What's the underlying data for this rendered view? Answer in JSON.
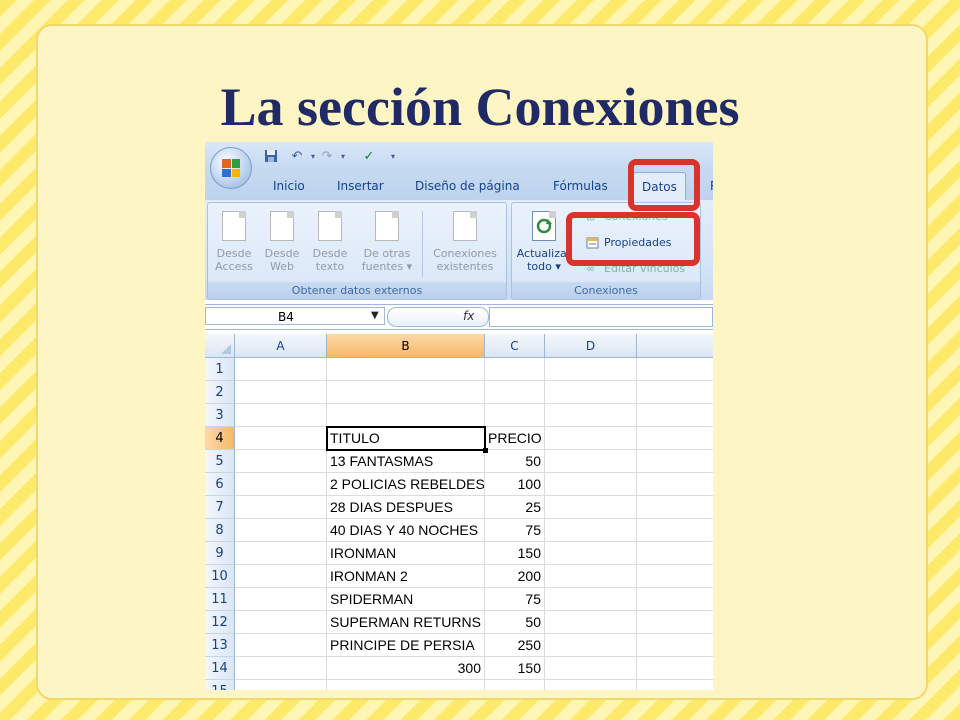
{
  "slide": {
    "title": "La sección Conexiones"
  },
  "excel": {
    "qat": {
      "icons": [
        "save-icon",
        "undo-icon",
        "redo-icon",
        "spellcheck-icon",
        "customize-icon"
      ]
    },
    "tabs": [
      {
        "label": "Inicio",
        "active": false
      },
      {
        "label": "Insertar",
        "active": false
      },
      {
        "label": "Diseño de página",
        "active": false
      },
      {
        "label": "Fórmulas",
        "active": false
      },
      {
        "label": "Datos",
        "active": true
      },
      {
        "label": "R",
        "active": false
      }
    ],
    "ribbon": {
      "groups": [
        {
          "label": "Obtener datos externos",
          "buttons": [
            {
              "line1": "Desde",
              "line2": "Access"
            },
            {
              "line1": "Desde",
              "line2": "Web"
            },
            {
              "line1": "Desde",
              "line2": "texto"
            },
            {
              "line1": "De otras",
              "line2": "fuentes ▾"
            },
            {
              "line1": "Conexiones",
              "line2": "existentes"
            }
          ]
        },
        {
          "label": "Conexiones",
          "big_button": {
            "line1": "Actualizar",
            "line2": "todo ▾"
          },
          "small_buttons": [
            {
              "label": "Conexiones",
              "enabled": false
            },
            {
              "label": "Propiedades",
              "enabled": true
            },
            {
              "label": "Editar vínculos",
              "enabled": false
            }
          ]
        }
      ]
    },
    "formula_bar": {
      "name_box": "B4",
      "fx": "fx",
      "content": ""
    },
    "columns": [
      "A",
      "B",
      "C",
      "D"
    ],
    "selected_column": "B",
    "rows": [
      {
        "n": "1",
        "b": "",
        "c": ""
      },
      {
        "n": "2",
        "b": "",
        "c": ""
      },
      {
        "n": "3",
        "b": "",
        "c": ""
      },
      {
        "n": "4",
        "b": "TITULO",
        "c": "PRECIO"
      },
      {
        "n": "5",
        "b": "13 FANTASMAS",
        "c": "50"
      },
      {
        "n": "6",
        "b": "2 POLICIAS REBELDES",
        "c": "100"
      },
      {
        "n": "7",
        "b": "28 DIAS DESPUES",
        "c": "25"
      },
      {
        "n": "8",
        "b": "40 DIAS Y 40 NOCHES",
        "c": "75"
      },
      {
        "n": "9",
        "b": "IRONMAN",
        "c": "150"
      },
      {
        "n": "10",
        "b": "IRONMAN 2",
        "c": "200"
      },
      {
        "n": "11",
        "b": "SPIDERMAN",
        "c": "75"
      },
      {
        "n": "12",
        "b": "SUPERMAN RETURNS",
        "c": "50"
      },
      {
        "n": "13",
        "b": "PRINCIPE DE PERSIA",
        "c": "250"
      },
      {
        "n": "14",
        "b": "300",
        "c": "150"
      },
      {
        "n": "15",
        "b": "",
        "c": ""
      }
    ],
    "active_cell": "B4",
    "selected_row": "4"
  }
}
